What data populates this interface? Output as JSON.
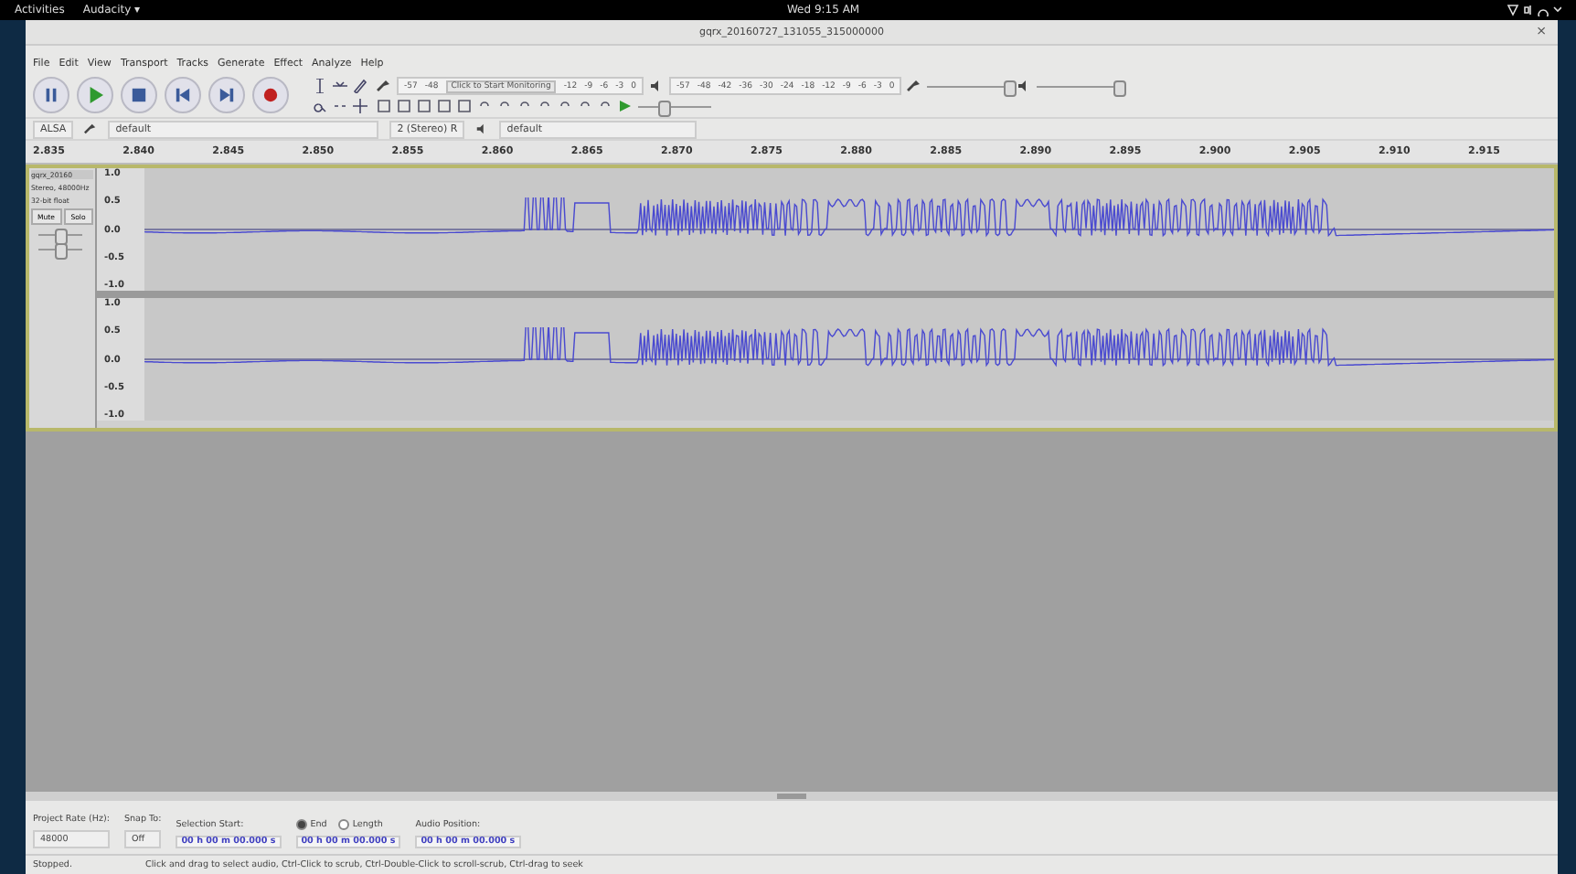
{
  "top_bar": {
    "activities": "Activities",
    "app_menu": "Audacity ▾",
    "clock": "Wed 9:15 AM"
  },
  "window": {
    "title": "gqrx_20160727_131055_315000000",
    "close": "×"
  },
  "menu": [
    "File",
    "Edit",
    "View",
    "Transport",
    "Tracks",
    "Generate",
    "Effect",
    "Analyze",
    "Help"
  ],
  "record_meter": {
    "label": "Click to Start Monitoring",
    "ticks": [
      "-57",
      "-48",
      "-12",
      "-9",
      "-6",
      "-3",
      "0"
    ]
  },
  "playback_meter": {
    "ticks": [
      "-57",
      "-48",
      "-42",
      "-36",
      "-30",
      "-24",
      "-18",
      "-12",
      "-9",
      "-6",
      "-3",
      "0"
    ]
  },
  "mixer": {
    "recording_volume": {
      "level": 0.97
    },
    "playback_volume": {
      "level": 0.97
    }
  },
  "play_at_speed": {
    "level": 0.35
  },
  "device_toolbar": {
    "host": "ALSA",
    "recording_device": "default",
    "channels": "2 (Stereo) R",
    "playback_device": "default"
  },
  "ruler": [
    "2.835",
    "2.840",
    "2.845",
    "2.850",
    "2.855",
    "2.860",
    "2.865",
    "2.870",
    "2.875",
    "2.880",
    "2.885",
    "2.890",
    "2.895",
    "2.900",
    "2.905",
    "2.910",
    "2.915"
  ],
  "track": {
    "name": "gqrx_20160",
    "info": [
      "Stereo, 48000Hz",
      "32-bit float"
    ],
    "mute": "Mute",
    "solo": "Solo",
    "gain": {
      "level": 0.5
    },
    "pan": {
      "level": 0.5
    },
    "selected": true,
    "channels": [
      {
        "scale": [
          "1.0",
          "0.5",
          "0.0",
          "-0.5",
          "-1.0"
        ]
      },
      {
        "scale": [
          "1.0",
          "0.5",
          "0.0",
          "-0.5",
          "-1.0"
        ]
      }
    ]
  },
  "selection_toolbar": {
    "project_rate_label": "Project Rate (Hz):",
    "project_rate": "48000",
    "snap_label": "Snap To:",
    "snap": "Off",
    "selection_start_label": "Selection Start:",
    "options": [
      {
        "label": "End",
        "selected": true
      },
      {
        "label": "Length",
        "selected": false
      }
    ],
    "audio_position_label": "Audio Position:",
    "times": [
      "00 h 00 m 00.000 s",
      "00 h 00 m 00.000 s",
      "00 h 00 m 00.000 s"
    ]
  },
  "status_bar": {
    "state": "Stopped.",
    "hint": "Click and drag to select audio, Ctrl-Click to scrub, Ctrl-Double-Click to scroll-scrub, Ctrl-drag to seek"
  }
}
